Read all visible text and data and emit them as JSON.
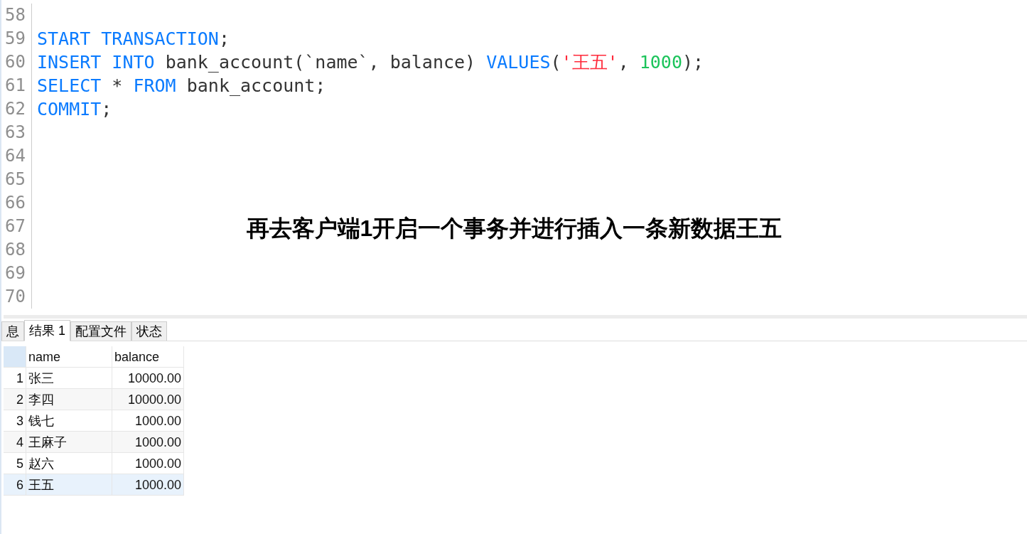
{
  "editor": {
    "lines": [
      {
        "number": "58"
      },
      {
        "number": "59",
        "tokens": [
          {
            "text": "START TRANSACTION",
            "kind": "keyword"
          },
          {
            "text": ";",
            "kind": "plain"
          }
        ]
      },
      {
        "number": "60",
        "tokens": [
          {
            "text": "INSERT INTO",
            "kind": "keyword"
          },
          {
            "text": " bank_account(`name`, balance) ",
            "kind": "plain"
          },
          {
            "text": "VALUES",
            "kind": "keyword"
          },
          {
            "text": "(",
            "kind": "plain"
          },
          {
            "text": "'王五'",
            "kind": "string"
          },
          {
            "text": ", ",
            "kind": "plain"
          },
          {
            "text": "1000",
            "kind": "number"
          },
          {
            "text": ");",
            "kind": "plain"
          }
        ]
      },
      {
        "number": "61",
        "tokens": [
          {
            "text": "SELECT",
            "kind": "keyword"
          },
          {
            "text": " * ",
            "kind": "plain"
          },
          {
            "text": "FROM",
            "kind": "keyword"
          },
          {
            "text": " bank_account;",
            "kind": "plain"
          }
        ]
      },
      {
        "number": "62",
        "tokens": [
          {
            "text": "COMMIT",
            "kind": "keyword"
          },
          {
            "text": ";",
            "kind": "plain"
          }
        ]
      },
      {
        "number": "63"
      },
      {
        "number": "64"
      },
      {
        "number": "65"
      },
      {
        "number": "66"
      },
      {
        "number": "67"
      },
      {
        "number": "68"
      },
      {
        "number": "69"
      },
      {
        "number": "70"
      }
    ]
  },
  "caption": "再去客户端1开启一个事务并进行插入一条新数据王五",
  "tabs": [
    {
      "label": "息",
      "selected": false
    },
    {
      "label": "结果 1",
      "selected": true
    },
    {
      "label": "配置文件",
      "selected": false
    },
    {
      "label": "状态",
      "selected": false
    }
  ],
  "table": {
    "columns": [
      "name",
      "balance"
    ],
    "rows": [
      {
        "number": "1",
        "name": "张三",
        "balance": "10000.00",
        "selected": false
      },
      {
        "number": "2",
        "name": "李四",
        "balance": "10000.00",
        "selected": false
      },
      {
        "number": "3",
        "name": "钱七",
        "balance": "1000.00",
        "selected": false
      },
      {
        "number": "4",
        "name": "王麻子",
        "balance": "1000.00",
        "selected": false
      },
      {
        "number": "5",
        "name": "赵六",
        "balance": "1000.00",
        "selected": false
      },
      {
        "number": "6",
        "name": "王五",
        "balance": "1000.00",
        "selected": true
      }
    ]
  }
}
